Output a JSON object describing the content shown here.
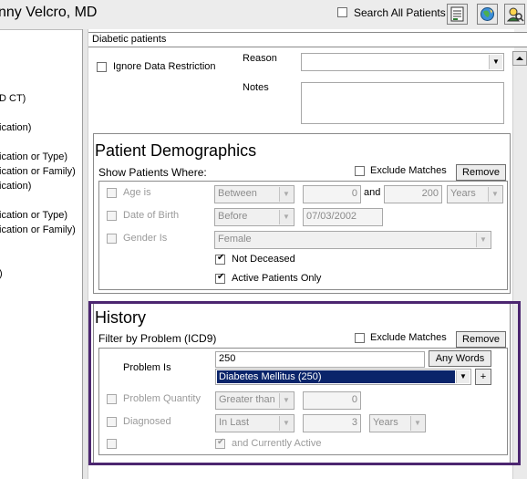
{
  "header": {
    "user_name": "nny Velcro, MD",
    "search_all_label": "Search All Patients",
    "search_all_checked": false,
    "icons": [
      "report-icon",
      "globe-icon",
      "person-search-icon"
    ]
  },
  "left_list": [
    "D CT)",
    "ication)",
    "ication or Type)",
    "ication or Family)",
    "ication)",
    "ication or Type)",
    "ication or Family)",
    ")"
  ],
  "search_name": "Diabetic patients",
  "ignore_restriction": {
    "label": "Ignore Data Restriction",
    "checked": false
  },
  "reason_label": "Reason",
  "reason_value": "",
  "notes_label": "Notes",
  "notes_value": "",
  "demographics": {
    "title": "Patient Demographics",
    "show_label": "Show Patients Where:",
    "exclude_label": "Exclude Matches",
    "exclude_checked": false,
    "remove_label": "Remove",
    "age": {
      "label": "Age is",
      "operator": "Between",
      "from": "0",
      "and_label": "and",
      "to": "200",
      "unit": "Years"
    },
    "dob": {
      "label": "Date of Birth",
      "operator": "Before",
      "date": "07/03/2002"
    },
    "gender": {
      "label": "Gender Is",
      "value": "Female"
    },
    "not_deceased": {
      "label": "Not Deceased",
      "checked": true
    },
    "active_only": {
      "label": "Active Patients Only",
      "checked": true
    }
  },
  "history": {
    "title": "History",
    "filter_label": "Filter by Problem (ICD9)",
    "exclude_label": "Exclude Matches",
    "exclude_checked": false,
    "remove_label": "Remove",
    "problem_label": "Problem Is",
    "problem_code": "250",
    "any_words_label": "Any Words",
    "problem_selected": "Diabetes Mellitus  (250)",
    "plus_label": "+",
    "quantity": {
      "label": "Problem Quantity",
      "operator": "Greater than",
      "value": "0"
    },
    "diagnosed": {
      "label": "Diagnosed",
      "operator": "In Last",
      "value": "3",
      "unit": "Years"
    },
    "currently_active": {
      "label": "and Currently Active",
      "checked": true
    }
  },
  "colors": {
    "highlight_border": "#4c2670",
    "selection_bg": "#0a246a"
  }
}
